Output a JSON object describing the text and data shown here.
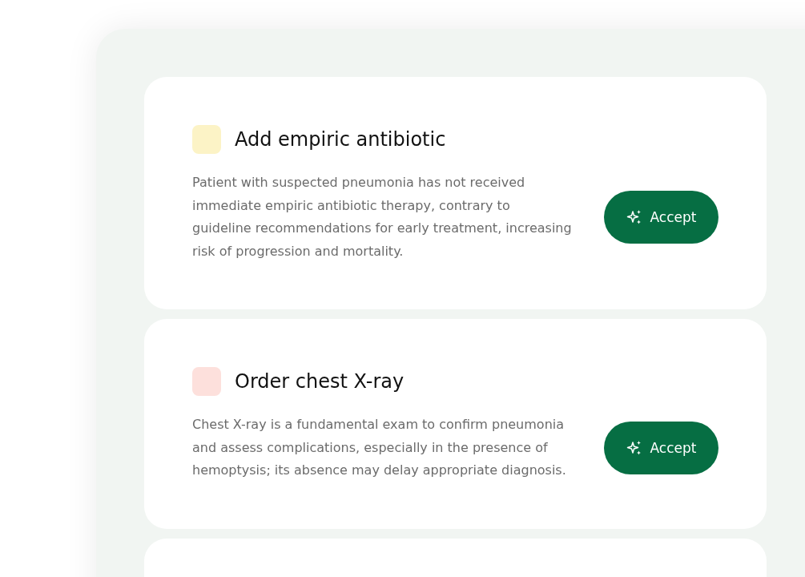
{
  "recommendations": [
    {
      "title": "Add empiric antibiotic",
      "color": "#fcf3c6",
      "description": "Patient with suspected pneumonia has not received immediate empiric antibiotic therapy, contrary to guideline recommendations for early treatment, increasing risk of progression and mortality.",
      "button": "Accept"
    },
    {
      "title": "Order chest X-ray",
      "color": "#fde0dc",
      "description": "Chest X-ray is a fundamental exam to confirm pneumonia and assess complications, especially in the presence of hemoptysis; its absence may delay appropriate diagnosis.",
      "button": "Accept"
    }
  ]
}
